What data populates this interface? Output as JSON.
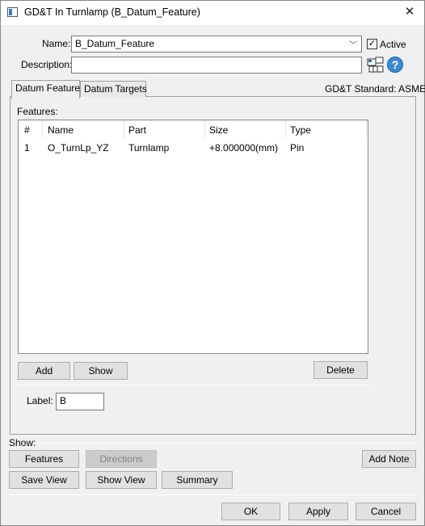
{
  "window": {
    "title": "GD&T In Turnlamp (B_Datum_Feature)",
    "close_glyph": "✕"
  },
  "form": {
    "name_label": "Name:",
    "name_value": "B_Datum_Feature",
    "active_label": "Active",
    "active_checked": true,
    "description_label": "Description:",
    "description_value": ""
  },
  "tabs": [
    {
      "label": "Datum Feature",
      "active": true
    },
    {
      "label": "Datum Targets",
      "active": false
    }
  ],
  "standard_text": "GD&T Standard: ASME",
  "features": {
    "label": "Features:",
    "columns": [
      "#",
      "Name",
      "Part",
      "Size",
      "Type"
    ],
    "rows": [
      {
        "num": "1",
        "name": "O_TurnLp_YZ",
        "part": "Turnlamp",
        "size": "+8.000000(mm)",
        "type": "Pin"
      }
    ]
  },
  "feature_buttons": {
    "add": "Add",
    "show": "Show",
    "delete": "Delete"
  },
  "datum_label": {
    "label": "Label:",
    "value": "B"
  },
  "show_section": {
    "label": "Show:",
    "features": "Features",
    "directions": "Directions",
    "add_note": "Add Note",
    "save_view": "Save View",
    "show_view": "Show View",
    "summary": "Summary"
  },
  "dialog_buttons": {
    "ok": "OK",
    "apply": "Apply",
    "cancel": "Cancel"
  },
  "icons": {
    "help": "?",
    "checkmark": "✓",
    "dropdown": "﹀"
  }
}
